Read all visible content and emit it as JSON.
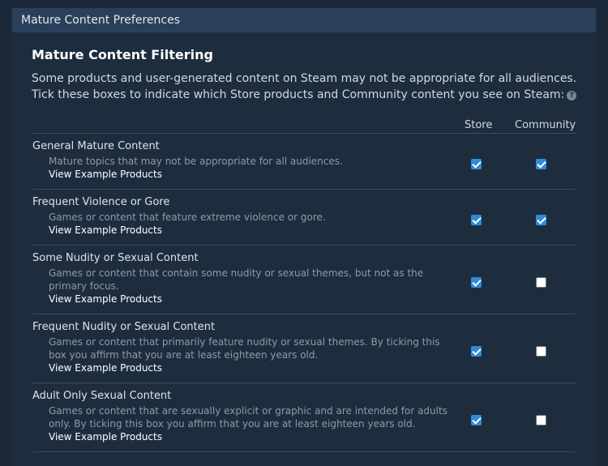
{
  "header": {
    "title": "Mature Content Preferences"
  },
  "section": {
    "title": "Mature Content Filtering",
    "intro_line1": "Some products and user-generated content on Steam may not be appropriate for all audiences.",
    "intro_line2": "Tick these boxes to indicate which Store products and Community content you see on Steam:",
    "help_glyph": "?"
  },
  "columns": {
    "store": "Store",
    "community": "Community"
  },
  "rows": [
    {
      "title": "General Mature Content",
      "description": "Mature topics that may not be appropriate for all audiences.",
      "link": "View Example Products",
      "store_checked": true,
      "community_checked": true
    },
    {
      "title": "Frequent Violence or Gore",
      "description": "Games or content that feature extreme violence or gore.",
      "link": "View Example Products",
      "store_checked": true,
      "community_checked": true
    },
    {
      "title": "Some Nudity or Sexual Content",
      "description": "Games or content that contain some nudity or sexual themes, but not as the primary focus.",
      "link": "View Example Products",
      "store_checked": true,
      "community_checked": false
    },
    {
      "title": "Frequent Nudity or Sexual Content",
      "description": "Games or content that primarily feature nudity or sexual themes. By ticking this box you affirm that you are at least eighteen years old.",
      "link": "View Example Products",
      "store_checked": true,
      "community_checked": false
    },
    {
      "title": "Adult Only Sexual Content",
      "description": "Games or content that are sexually explicit or graphic and are intended for adults only. By ticking this box you affirm that you are at least eighteen years old.",
      "link": "View Example Products",
      "store_checked": true,
      "community_checked": false
    }
  ],
  "colors": {
    "background": "#1b2838",
    "header": "#2a3f5a",
    "checkbox_on": "#2f8cd6"
  }
}
